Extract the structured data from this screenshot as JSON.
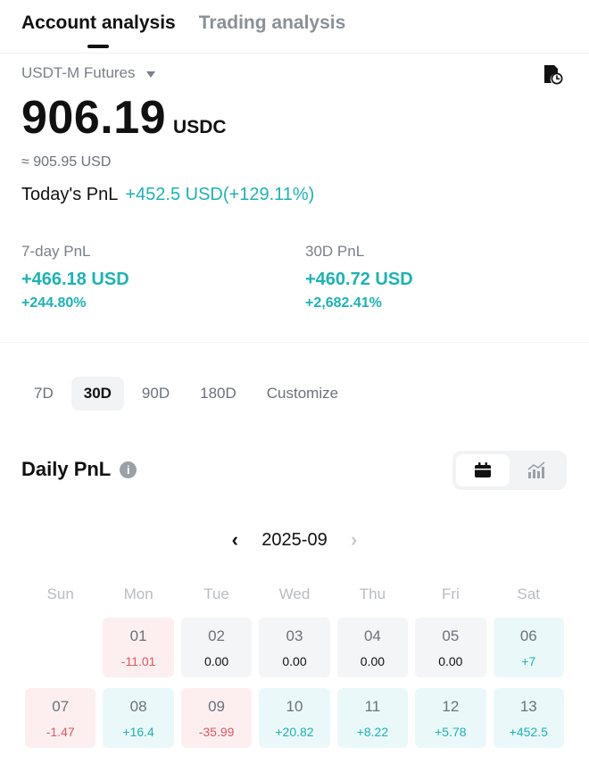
{
  "tabs": [
    {
      "label": "Account analysis",
      "active": true
    },
    {
      "label": "Trading analysis",
      "active": false
    }
  ],
  "account": {
    "selector": "USDT-M Futures",
    "balance": "906.19",
    "unit": "USDC",
    "approx": "≈ 905.95 USD"
  },
  "today": {
    "label": "Today's PnL",
    "value": "+452.5 USD(+129.11%)"
  },
  "pnl7": {
    "label": "7-day PnL",
    "usd": "+466.18 USD",
    "pct": "+244.80%"
  },
  "pnl30": {
    "label": "30D PnL",
    "usd": "+460.72 USD",
    "pct": "+2,682.41%"
  },
  "ranges": [
    {
      "label": "7D",
      "active": false
    },
    {
      "label": "30D",
      "active": true
    },
    {
      "label": "90D",
      "active": false
    },
    {
      "label": "180D",
      "active": false
    },
    {
      "label": "Customize",
      "active": false
    }
  ],
  "daily": {
    "title": "Daily PnL",
    "info": "i",
    "month": "2025-09",
    "prev": "‹",
    "next": "›",
    "weekdays": [
      "Sun",
      "Mon",
      "Tue",
      "Wed",
      "Thu",
      "Fri",
      "Sat"
    ],
    "week1": [
      {
        "day": "",
        "val": "",
        "kind": "empty"
      },
      {
        "day": "01",
        "val": "-11.01",
        "kind": "neg"
      },
      {
        "day": "02",
        "val": "0.00",
        "kind": "zero"
      },
      {
        "day": "03",
        "val": "0.00",
        "kind": "zero"
      },
      {
        "day": "04",
        "val": "0.00",
        "kind": "zero"
      },
      {
        "day": "05",
        "val": "0.00",
        "kind": "zero"
      },
      {
        "day": "06",
        "val": "+7",
        "kind": "pos"
      }
    ],
    "week2": [
      {
        "day": "07",
        "val": "-1.47",
        "kind": "neg"
      },
      {
        "day": "08",
        "val": "+16.4",
        "kind": "pos"
      },
      {
        "day": "09",
        "val": "-35.99",
        "kind": "neg"
      },
      {
        "day": "10",
        "val": "+20.82",
        "kind": "pos"
      },
      {
        "day": "11",
        "val": "+8.22",
        "kind": "pos"
      },
      {
        "day": "12",
        "val": "+5.78",
        "kind": "pos"
      },
      {
        "day": "13",
        "val": "+452.5",
        "kind": "pos"
      }
    ]
  },
  "colors": {
    "accent_positive": "#1db2b5",
    "accent_negative": "#e25563"
  }
}
